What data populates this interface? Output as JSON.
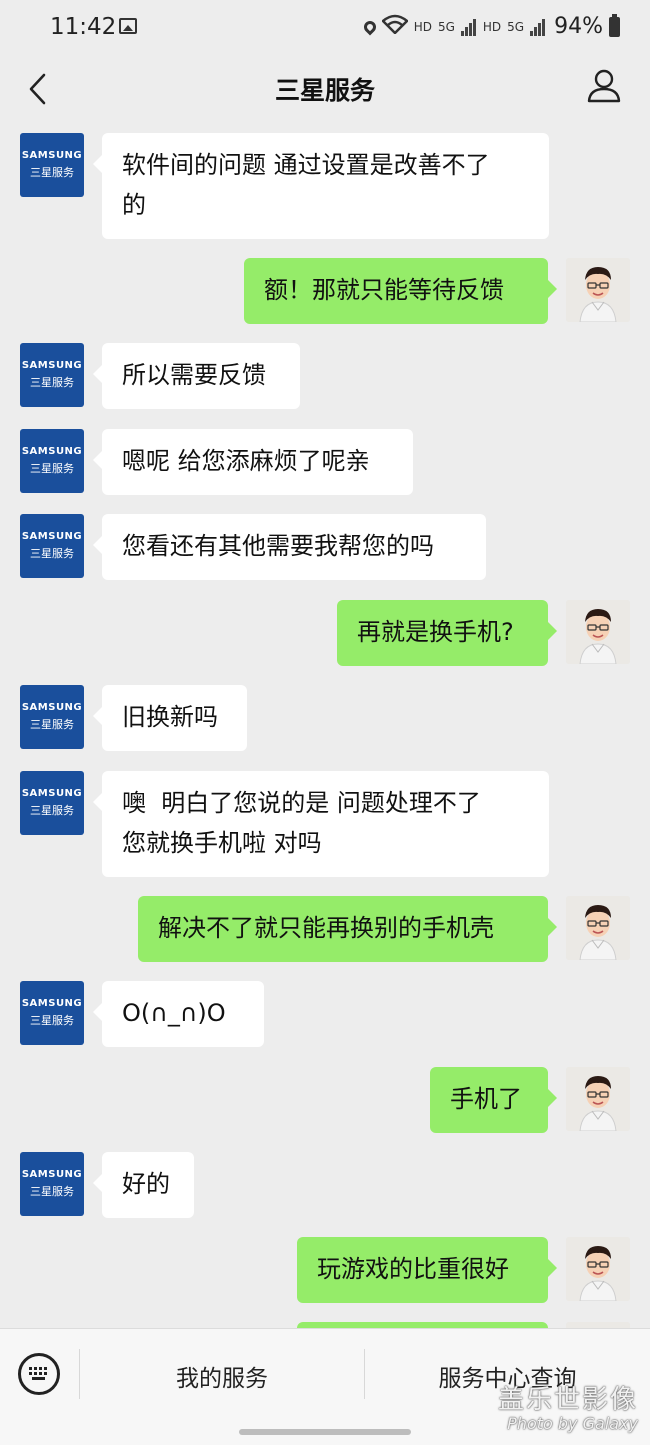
{
  "status_bar": {
    "time": "11:42",
    "hd1": "HD",
    "net1": "5G",
    "hd2": "HD",
    "net2": "5G",
    "battery": "94%"
  },
  "header": {
    "title": "三星服务"
  },
  "avatars": {
    "samsung_brand": "SAMSUNG",
    "samsung_sub": "三星服务"
  },
  "messages": [
    {
      "side": "in",
      "text": "软件间的问题 通过设置是改善不了\n的"
    },
    {
      "side": "out",
      "text": "额！那就只能等待反馈"
    },
    {
      "side": "in",
      "text": "所以需要反馈"
    },
    {
      "side": "in",
      "text": "嗯呢 给您添麻烦了呢亲"
    },
    {
      "side": "in",
      "text": "您看还有其他需要我帮您的吗"
    },
    {
      "side": "out",
      "text": "再就是换手机?"
    },
    {
      "side": "in",
      "text": "旧换新吗"
    },
    {
      "side": "in",
      "text": "噢  明白了您说的是 问题处理不了\n您就换手机啦 对吗"
    },
    {
      "side": "out",
      "text": "解决不了就只能再换别的手机壳"
    },
    {
      "side": "in",
      "text": "O(∩_∩)O"
    },
    {
      "side": "out",
      "text": "手机了"
    },
    {
      "side": "in",
      "text": "好的"
    },
    {
      "side": "out",
      "text": "玩游戏的比重很好"
    },
    {
      "side": "out",
      "text": ""
    }
  ],
  "bottom_bar": {
    "menu_1": "我的服务",
    "menu_2": "服务中心查询"
  },
  "watermark": {
    "line1": "盖乐世影像",
    "line2": "Photo by Galaxy"
  }
}
